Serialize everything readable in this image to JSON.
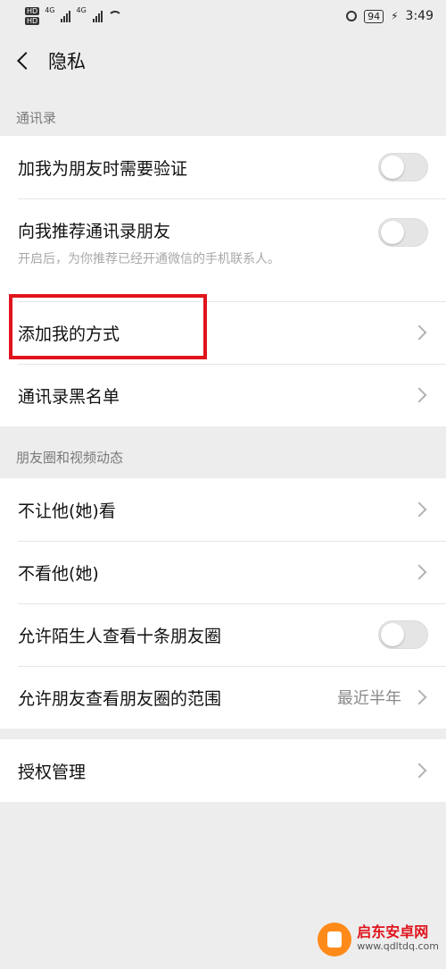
{
  "status_bar": {
    "hd1": "HD",
    "hd2": "HD",
    "net1": "4G",
    "net2": "4G",
    "battery": "94",
    "time": "3:49"
  },
  "nav": {
    "title": "隐私"
  },
  "sections": {
    "contacts": {
      "header": "通讯录",
      "verify_label": "加我为朋友时需要验证",
      "verify_on": false,
      "recommend_label": "向我推荐通讯录朋友",
      "recommend_desc": "开启后，为你推荐已经开通微信的手机联系人。",
      "recommend_on": false,
      "add_methods_label": "添加我的方式",
      "blacklist_label": "通讯录黑名单"
    },
    "moments": {
      "header": "朋友圈和视频动态",
      "hide_from_label": "不让他(她)看",
      "dont_see_label": "不看他(她)",
      "strangers_label": "允许陌生人查看十条朋友圈",
      "strangers_on": false,
      "range_label": "允许朋友查看朋友圈的范围",
      "range_value": "最近半年"
    },
    "auth": {
      "label": "授权管理"
    }
  },
  "watermark": {
    "name": "启东安卓网",
    "url": "www.qdltdq.com"
  },
  "colors": {
    "highlight": "#e0141c",
    "background": "#ededed"
  }
}
